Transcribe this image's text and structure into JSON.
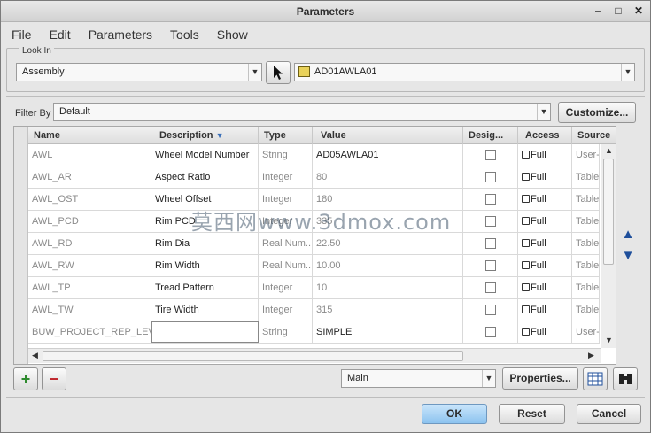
{
  "window": {
    "title": "Parameters",
    "controls": [
      "–",
      "□",
      "✕"
    ]
  },
  "menu": [
    "File",
    "Edit",
    "Parameters",
    "Tools",
    "Show"
  ],
  "lookin": {
    "legend": "Look In",
    "context_value": "Assembly",
    "model_value": "AD01AWLA01"
  },
  "filter": {
    "label": "Filter By",
    "value": "Default",
    "customize_label": "Customize..."
  },
  "table": {
    "columns": [
      "Name",
      "Description",
      "Type",
      "Value",
      "Desig...",
      "Access",
      "Source"
    ],
    "rows": [
      {
        "name": "AWL",
        "description": "Wheel Model Number",
        "type": "String",
        "value": "AD05AWLA01",
        "access": "Full",
        "source": "User-"
      },
      {
        "name": "AWL_AR",
        "description": "Aspect Ratio",
        "type": "Integer",
        "value": "80",
        "access": "Full",
        "source": "Table"
      },
      {
        "name": "AWL_OST",
        "description": "Wheel Offset",
        "type": "Integer",
        "value": "180",
        "access": "Full",
        "source": "Table"
      },
      {
        "name": "AWL_PCD",
        "description": "Rim PCD",
        "type": "Integer",
        "value": "335",
        "access": "Full",
        "source": "Table"
      },
      {
        "name": "AWL_RD",
        "description": "Rim Dia",
        "type": "Real Num...",
        "value": "22.50",
        "access": "Full",
        "source": "Table"
      },
      {
        "name": "AWL_RW",
        "description": "Rim Width",
        "type": "Real Num...",
        "value": "10.00",
        "access": "Full",
        "source": "Table"
      },
      {
        "name": "AWL_TP",
        "description": "Tread Pattern",
        "type": "Integer",
        "value": "10",
        "access": "Full",
        "source": "Table"
      },
      {
        "name": "AWL_TW",
        "description": "Tire Width",
        "type": "Integer",
        "value": "315",
        "access": "Full",
        "source": "Table"
      },
      {
        "name": "BUW_PROJECT_REP_LEV...",
        "description": "",
        "type": "String",
        "value": "SIMPLE",
        "access": "Full",
        "source": "User-"
      }
    ]
  },
  "bottom": {
    "add_symbol": "+",
    "remove_symbol": "−",
    "view_value": "Main",
    "properties_label": "Properties...",
    "ok_label": "OK",
    "reset_label": "Reset",
    "cancel_label": "Cancel"
  },
  "watermark": "莫西网www.3dmox.com",
  "colors": {
    "ok_button": "#8cc3ef",
    "arrow_blue": "#1f4f9b",
    "add_green": "#2e8b2e",
    "remove_red": "#c0282e"
  }
}
